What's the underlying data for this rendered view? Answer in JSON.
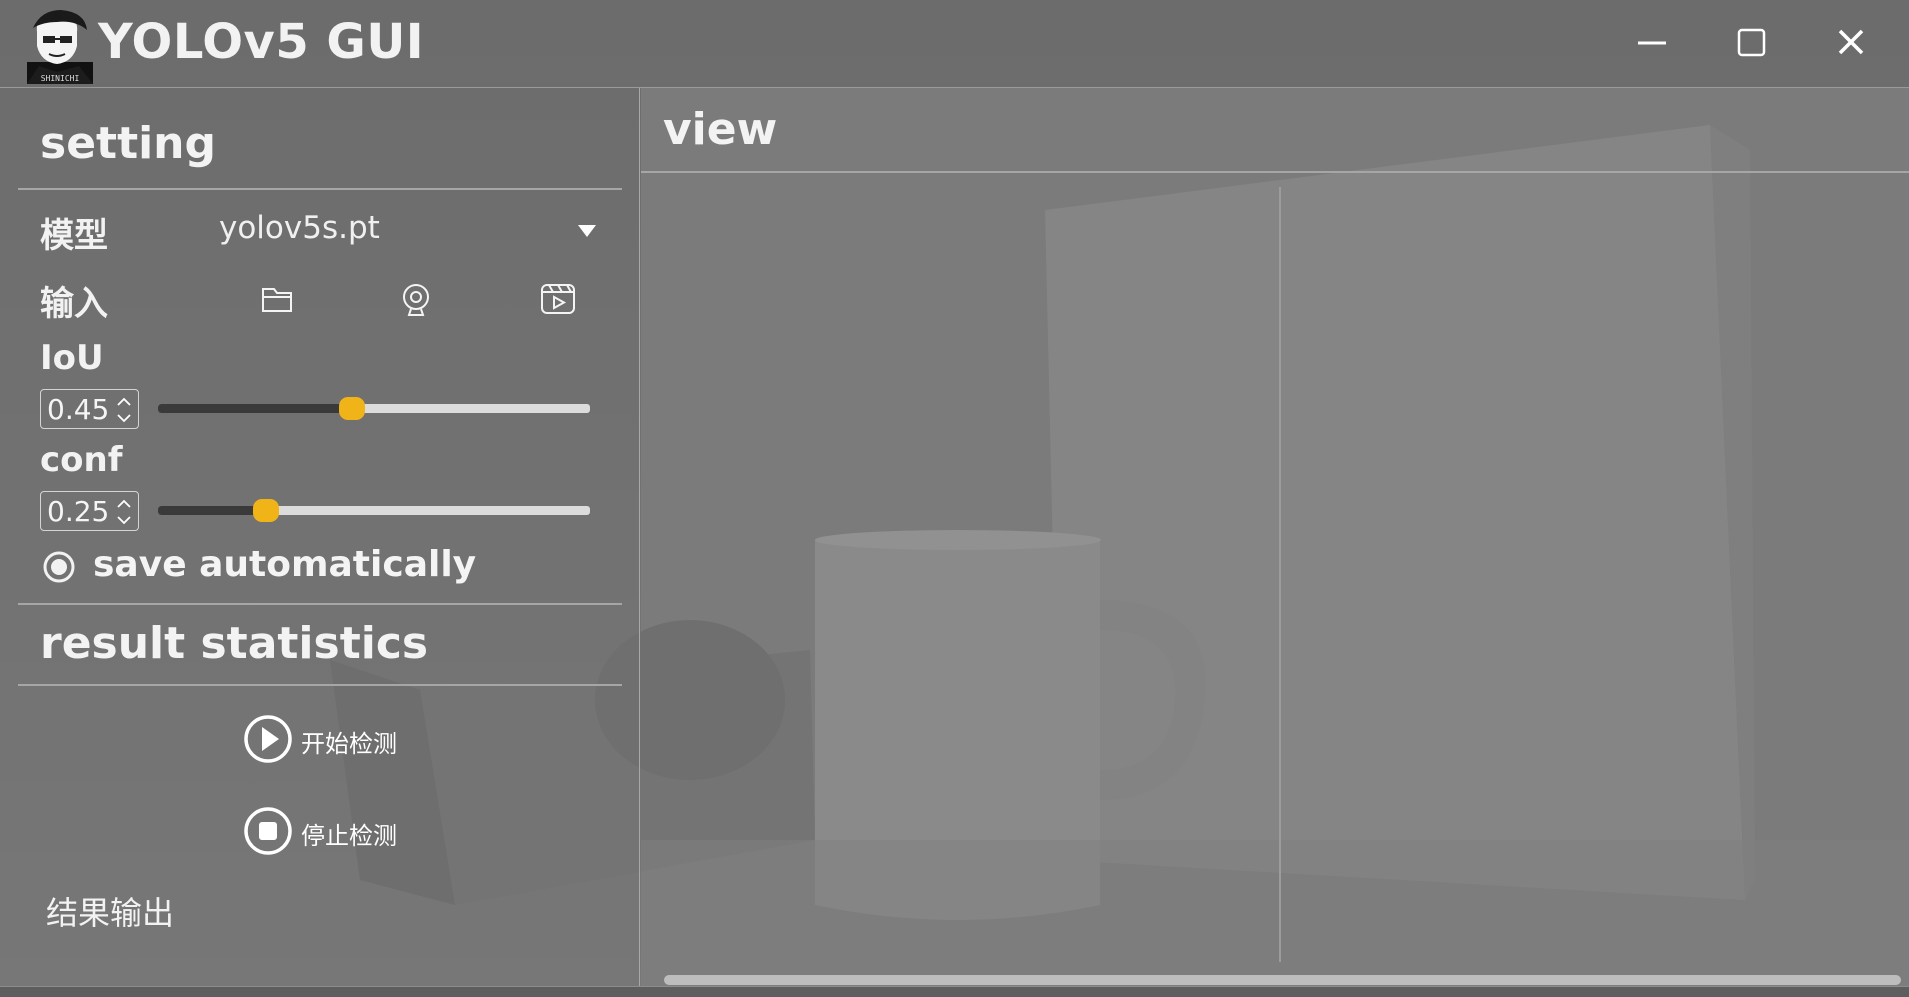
{
  "window": {
    "title": "YOLOv5 GUI",
    "logo_text": "SHINICHI",
    "controls": [
      "minimize-icon",
      "maximize-icon",
      "close-icon"
    ]
  },
  "setting": {
    "header": "setting",
    "model": {
      "label": "模型",
      "value": "yolov5s.pt",
      "icon": "chevron-down-icon"
    },
    "input": {
      "label": "输入",
      "sources": [
        "folder-icon",
        "webcam-icon",
        "video-icon"
      ]
    },
    "iou": {
      "label": "IoU",
      "value": "0.45",
      "slider_fraction": 0.45
    },
    "conf": {
      "label": "conf",
      "value": "0.25",
      "slider_fraction": 0.25
    },
    "save": {
      "label": "save automatically",
      "checked": true
    }
  },
  "results": {
    "header": "result statistics",
    "start_label": "开始检测",
    "stop_label": "停止检测",
    "output_label": "结果输出"
  },
  "view": {
    "header": "view"
  },
  "colors": {
    "accent": "#f1b418",
    "panel_text": "#f0f0f0",
    "divider": "#a6a6a6",
    "background": "#6a6a6a"
  }
}
